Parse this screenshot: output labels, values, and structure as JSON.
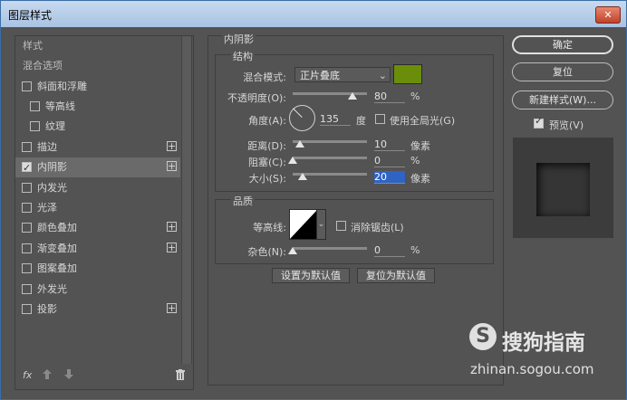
{
  "window": {
    "title": "图层样式",
    "close": "✕"
  },
  "styles_list": {
    "header": "样式",
    "blend_options": "混合选项",
    "items": [
      {
        "label": "斜面和浮雕",
        "checked": false,
        "plus": false
      },
      {
        "label": "等高线",
        "checked": false,
        "plus": false
      },
      {
        "label": "纹理",
        "checked": false,
        "plus": false
      },
      {
        "label": "描边",
        "checked": false,
        "plus": true
      },
      {
        "label": "内阴影",
        "checked": true,
        "plus": true
      },
      {
        "label": "内发光",
        "checked": false,
        "plus": false
      },
      {
        "label": "光泽",
        "checked": false,
        "plus": false
      },
      {
        "label": "颜色叠加",
        "checked": false,
        "plus": true
      },
      {
        "label": "渐变叠加",
        "checked": false,
        "plus": true
      },
      {
        "label": "图案叠加",
        "checked": false,
        "plus": false
      },
      {
        "label": "外发光",
        "checked": false,
        "plus": false
      },
      {
        "label": "投影",
        "checked": false,
        "plus": true
      }
    ],
    "fx": "fx",
    "plus_glyph": "+"
  },
  "inner_shadow": {
    "title": "内阴影",
    "structure_title": "结构",
    "blend_mode_label": "混合模式:",
    "blend_mode_value": "正片叠底",
    "color": "#6b8e0a",
    "opacity_label": "不透明度(O):",
    "opacity_value": "80",
    "opacity_level": 80,
    "percent": "%",
    "angle_label": "角度(A):",
    "angle_value": "135",
    "degree_unit": "度",
    "global_light_label": "使用全局光(G)",
    "distance_label": "距离(D):",
    "distance_value": "10",
    "choke_label": "阻塞(C):",
    "choke_value": "0",
    "size_label": "大小(S):",
    "size_value": "20",
    "pixel_unit": "像素",
    "quality_title": "品质",
    "contour_label": "等高线:",
    "antialias_label": "消除锯齿(L)",
    "noise_label": "杂色(N):",
    "noise_value": "0",
    "set_default": "设置为默认值",
    "reset_default": "复位为默认值"
  },
  "actions": {
    "ok": "确定",
    "reset": "复位",
    "new_style": "新建样式(W)...",
    "preview_label": "预览(V)",
    "preview_checked": true
  },
  "watermark": {
    "brand": "搜狗指南",
    "url": "zhinan.sogou.com",
    "logo": "S"
  }
}
